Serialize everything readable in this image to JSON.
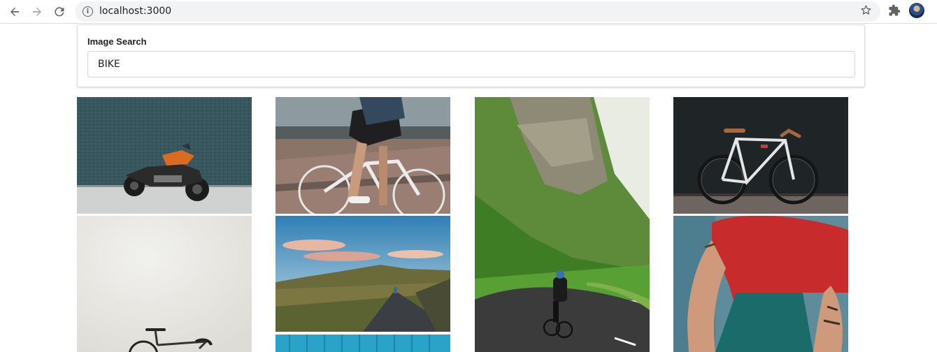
{
  "browser": {
    "url": "localhost:3000",
    "icons": [
      "back-arrow-icon",
      "forward-arrow-icon",
      "reload-icon",
      "info-icon",
      "star-icon",
      "extensions-icon",
      "profile-avatar"
    ]
  },
  "search": {
    "label": "Image Search",
    "value": "BIKE"
  },
  "images": [
    {
      "subject": "motorcycle against tiled wall"
    },
    {
      "subject": "cyclist legs on street"
    },
    {
      "subject": "cyclist on mountain road"
    },
    {
      "subject": "white fixed-gear bike against dark wall"
    },
    {
      "subject": "white bicycle against white wall"
    },
    {
      "subject": "cyclist on open road at sunset hills"
    },
    {
      "subject": "blue wall"
    },
    {
      "subject": "man in red shirt on bike"
    }
  ],
  "colors": {
    "omnibox_bg": "#f1f3f4",
    "card_border": "#dcdcdc"
  }
}
